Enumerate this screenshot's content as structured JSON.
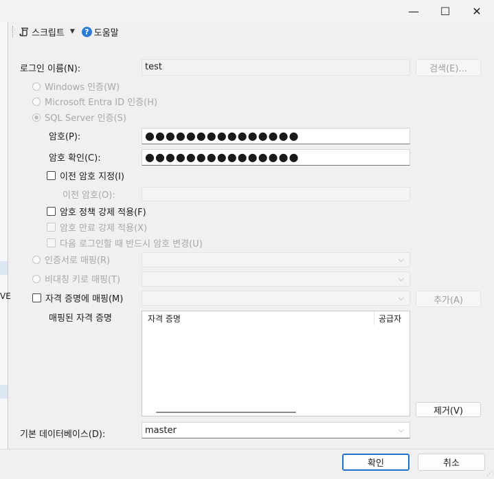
{
  "window": {
    "minimize_glyph": "—",
    "maximize_glyph": "☐",
    "close_glyph": "✕"
  },
  "left_pane": {
    "cut_text": "VE"
  },
  "toolbar": {
    "script_label": "스크립트",
    "help_label": "도움말",
    "script_icon": "script-icon",
    "help_icon": "help-icon"
  },
  "login": {
    "name_label": "로그인 이름(N):",
    "name_value": "test",
    "search_button": "검색(E)...",
    "auth_windows": "Windows 인증(W)",
    "auth_entra": "Microsoft Entra ID 인증(H)",
    "auth_sql": "SQL Server 인증(S)",
    "password_label": "암호(P):",
    "password_value": "●●●●●●●●●●●●●●●",
    "confirm_label": "암호 확인(C):",
    "confirm_value": "●●●●●●●●●●●●●●●",
    "old_pw_check": "이전 암호 지정(I)",
    "old_pw_label": "이전 암호(O):",
    "policy_check": "암호 정책 강제 적용(F)",
    "expire_check": "암호 만료 강제 적용(X)",
    "mustchange_check": "다음 로그인할 때 반드시 암호 변경(U)",
    "cert_radio": "인증서로 매핑(R)",
    "asym_radio": "비대칭 키로 매핑(T)",
    "cred_check": "자격 증명에 매핑(M)",
    "add_button": "추가(A)",
    "mapped_label": "매핑된 자격 증명",
    "list_columns": [
      "자격 증명",
      "공급자"
    ],
    "remove_button": "제거(V)",
    "default_db_label": "기본 데이터베이스(D):",
    "default_db_value": "master"
  },
  "footer": {
    "ok_button": "확인",
    "cancel_button": "취소"
  }
}
